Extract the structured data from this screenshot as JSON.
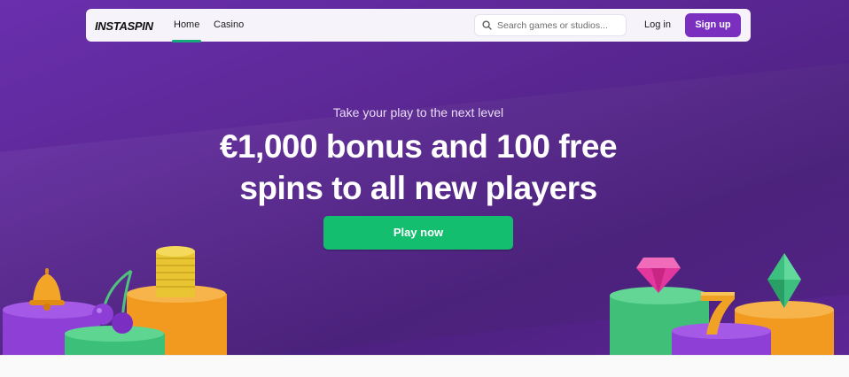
{
  "brand": {
    "logo_text": "INSTASPIN"
  },
  "nav": {
    "links": [
      {
        "label": "Home",
        "active": true
      },
      {
        "label": "Casino",
        "active": false
      }
    ]
  },
  "search": {
    "placeholder": "Search games or studios..."
  },
  "account": {
    "login_label": "Log in",
    "signup_label": "Sign up"
  },
  "hero": {
    "tagline": "Take your play to the next level",
    "headline_line1": "€1,000 bonus and 100 free",
    "headline_line2": "spins to all new players",
    "cta_label": "Play now"
  },
  "colors": {
    "hero_purple": "#5a2792",
    "signup_purple": "#7a2fbf",
    "cta_green": "#13bf6f",
    "active_underline": "#17a87a"
  },
  "icons": {
    "search": "search-icon",
    "decor_left": [
      "bell-icon",
      "cherries-icon",
      "coin-stack-icon"
    ],
    "decor_right": [
      "diamond-gem-icon",
      "seven-icon",
      "emerald-gem-icon"
    ]
  }
}
